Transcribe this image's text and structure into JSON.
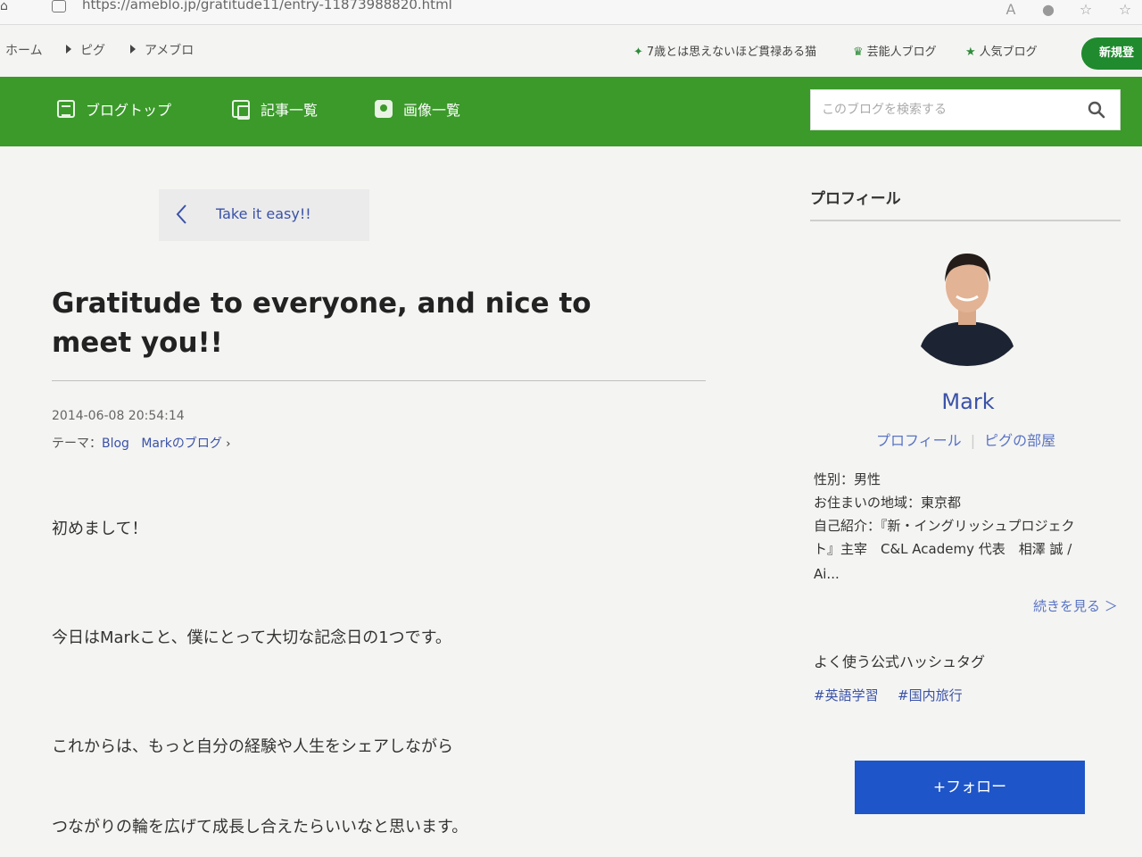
{
  "browser": {
    "url": "https://ameblo.jp/gratitude11/entry-11873988820.html"
  },
  "topnav": {
    "breadcrumbs": [
      "ホーム",
      "ピグ",
      "アメブロ"
    ],
    "links": [
      "7歳とは思えないほど貫禄ある猫",
      "芸能人ブログ",
      "人気ブログ"
    ],
    "new_button": "新規登"
  },
  "blognav": {
    "items": [
      "ブログトップ",
      "記事一覧",
      "画像一覧"
    ],
    "search_placeholder": "このブログを検索する"
  },
  "article": {
    "prev_link": "Take it easy!!",
    "title": "Gratitude to everyone, and nice to meet you!!",
    "date": "2014-06-08 20:54:14",
    "theme_label": "テーマ：",
    "theme_values": [
      "Blog",
      "Markのブログ"
    ],
    "paragraphs": [
      "初めまして！",
      "今日はMarkこと、僕にとって大切な記念日の1つです。",
      "これからは、もっと自分の経験や人生をシェアしながら",
      "つながりの輪を広げて成長し合えたらいいなと思います。"
    ]
  },
  "profile": {
    "heading": "プロフィール",
    "name": "Mark",
    "links": [
      "プロフィール",
      "ピグの部屋"
    ],
    "gender": "性別：男性",
    "region": "お住まいの地域：東京都",
    "intro_line1": "自己紹介：『新・イングリッシュプロジェク",
    "intro_line2": "ト』主宰　C&L Academy 代表　相澤 誠 /",
    "intro_line3": "Ai...",
    "more": "続きを見る ＞",
    "hashtag_heading": "よく使う公式ハッシュタグ",
    "hashtags": [
      "#英語学習",
      "#国内旅行"
    ],
    "follow_button": "+フォロー"
  },
  "colors": {
    "header_green": "#3b9a2a",
    "link_blue": "#3a52a8",
    "follow_blue": "#1e55c8"
  }
}
